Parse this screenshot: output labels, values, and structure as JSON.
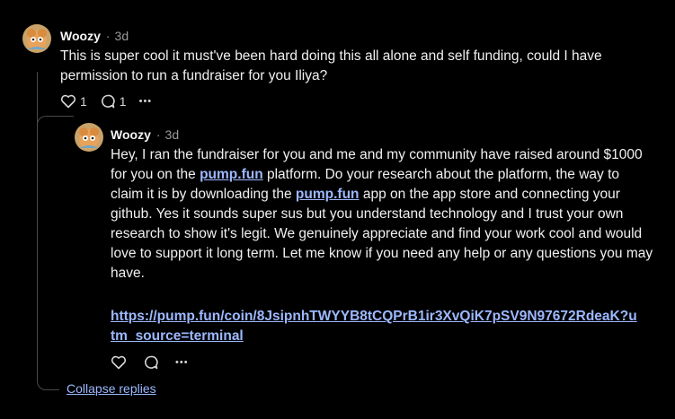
{
  "comment": {
    "author": "Woozy",
    "separator": "·",
    "time": "3d",
    "text": "This is super cool it must've been hard doing this all alone and self funding, could I have permission to run a fundraiser for you Iliya?",
    "like_count": "1",
    "reply_count": "1",
    "more_label": "•••"
  },
  "reply": {
    "author": "Woozy",
    "separator": "·",
    "time": "3d",
    "text_1": "Hey, I ran the fundraiser for you and me and my community have raised around $1000 for you on the ",
    "link_1": "pump.fun",
    "text_2": " platform.  Do your research about the platform, the way to claim it is by downloading the ",
    "link_2": "pump.fun",
    "text_3": " app on the app store and connecting your github. Yes it sounds super sus but you understand technology and I trust your own research to show it's legit. We genuinely appreciate and find your work cool and would love to support it long term. Let me know if you need any help or any questions you may have.",
    "url": "https://pump.fun/coin/8JsipnhTWYYB8tCQPrB1ir3XvQiK7pSV9N97672RdeaK?utm_source=terminal",
    "more_label": "•••"
  },
  "collapse_label": "Collapse replies",
  "colors": {
    "background": "#000000",
    "link": "#9db8ff",
    "thread_line": "#4a4a4a"
  }
}
